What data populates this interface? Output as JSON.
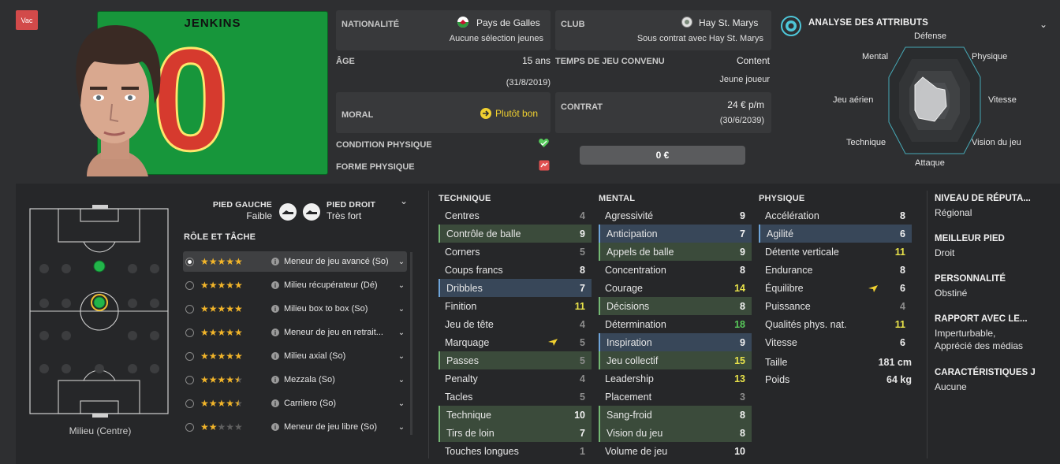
{
  "status_badge": "Vac",
  "player": {
    "name": "JENKINS",
    "number": "0"
  },
  "nationality": {
    "label": "NATIONALITÉ",
    "value": "Pays de Galles",
    "sub": "Aucune sélection jeunes"
  },
  "club": {
    "label": "CLUB",
    "value": "Hay St. Marys",
    "sub": "Sous contrat avec Hay St. Marys"
  },
  "age": {
    "label": "ÂGE",
    "value": "15 ans",
    "sub": "(31/8/2019)"
  },
  "playing_time": {
    "label": "TEMPS DE JEU CONVENU",
    "value": "Content",
    "sub": "Jeune joueur"
  },
  "morale": {
    "label": "MORAL",
    "value": "Plutôt bon"
  },
  "contract": {
    "label": "CONTRAT",
    "value": "24 € p/m",
    "sub": "(30/6/2039)"
  },
  "condition": {
    "label": "CONDITION PHYSIQUE"
  },
  "sharpness": {
    "label": "FORME PHYSIQUE"
  },
  "value_bar": "0 €",
  "analysis": {
    "title": "ANALYSE DES ATTRIBUTS",
    "labels": {
      "defense": "Défense",
      "physique": "Physique",
      "vitesse": "Vitesse",
      "vision": "Vision du jeu",
      "attaque": "Attaque",
      "technique": "Technique",
      "aerien": "Jeu aérien",
      "mental": "Mental"
    }
  },
  "feet": {
    "left_label": "PIED GAUCHE",
    "left_value": "Faible",
    "right_label": "PIED DROIT",
    "right_value": "Très fort"
  },
  "position_label": "Milieu (Centre)",
  "roles_title": "RÔLE ET TÂCHE",
  "roles": [
    {
      "name": "Meneur de jeu avancé (So)",
      "stars": 5
    },
    {
      "name": "Milieu récupérateur (Dé)",
      "stars": 5
    },
    {
      "name": "Milieu box to box (So)",
      "stars": 5
    },
    {
      "name": "Meneur de jeu en retrait...",
      "stars": 5
    },
    {
      "name": "Milieu axial (So)",
      "stars": 5
    },
    {
      "name": "Mezzala (So)",
      "stars": 4.5
    },
    {
      "name": "Carrilero (So)",
      "stars": 4.5
    },
    {
      "name": "Meneur de jeu libre (So)",
      "stars": 2
    }
  ],
  "technique": {
    "title": "TECHNIQUE",
    "rows": [
      {
        "name": "Centres",
        "value": "4"
      },
      {
        "name": "Contrôle de balle",
        "value": "9"
      },
      {
        "name": "Corners",
        "value": "5"
      },
      {
        "name": "Coups francs",
        "value": "8"
      },
      {
        "name": "Dribbles",
        "value": "7"
      },
      {
        "name": "Finition",
        "value": "11"
      },
      {
        "name": "Jeu de tête",
        "value": "4"
      },
      {
        "name": "Marquage",
        "value": "5"
      },
      {
        "name": "Passes",
        "value": "5"
      },
      {
        "name": "Penalty",
        "value": "4"
      },
      {
        "name": "Tacles",
        "value": "5"
      },
      {
        "name": "Technique",
        "value": "10"
      },
      {
        "name": "Tirs de loin",
        "value": "7"
      },
      {
        "name": "Touches longues",
        "value": "1"
      }
    ]
  },
  "mental": {
    "title": "MENTAL",
    "rows": [
      {
        "name": "Agressivité",
        "value": "9"
      },
      {
        "name": "Anticipation",
        "value": "7"
      },
      {
        "name": "Appels de balle",
        "value": "9"
      },
      {
        "name": "Concentration",
        "value": "8"
      },
      {
        "name": "Courage",
        "value": "14"
      },
      {
        "name": "Décisions",
        "value": "8"
      },
      {
        "name": "Détermination",
        "value": "18"
      },
      {
        "name": "Inspiration",
        "value": "9"
      },
      {
        "name": "Jeu collectif",
        "value": "15"
      },
      {
        "name": "Leadership",
        "value": "13"
      },
      {
        "name": "Placement",
        "value": "3"
      },
      {
        "name": "Sang-froid",
        "value": "8"
      },
      {
        "name": "Vision du jeu",
        "value": "8"
      },
      {
        "name": "Volume de jeu",
        "value": "10"
      }
    ]
  },
  "physique": {
    "title": "PHYSIQUE",
    "rows": [
      {
        "name": "Accélération",
        "value": "8"
      },
      {
        "name": "Agilité",
        "value": "6"
      },
      {
        "name": "Détente verticale",
        "value": "11"
      },
      {
        "name": "Endurance",
        "value": "8"
      },
      {
        "name": "Équilibre",
        "value": "6"
      },
      {
        "name": "Puissance",
        "value": "4"
      },
      {
        "name": "Qualités phys. nat.",
        "value": "11"
      },
      {
        "name": "Vitesse",
        "value": "6"
      }
    ],
    "height_label": "Taille",
    "height": "181 cm",
    "weight_label": "Poids",
    "weight": "64 kg"
  },
  "side_info": [
    {
      "title": "NIVEAU DE RÉPUTA...",
      "value": "Régional"
    },
    {
      "title": "MEILLEUR PIED",
      "value": "Droit"
    },
    {
      "title": "PERSONNALITÉ",
      "value": "Obstiné"
    },
    {
      "title": "RAPPORT AVEC LE...",
      "value": "Imperturbable,",
      "value2": "Apprécié des médias"
    },
    {
      "title": "CARACTÉRISTIQUES J",
      "value": "Aucune"
    }
  ],
  "colors": {
    "kit_green": "#17963b",
    "kit_red": "#d63a2e",
    "highlight_green": "#3b4b3b",
    "highlight_blue": "#384759"
  }
}
